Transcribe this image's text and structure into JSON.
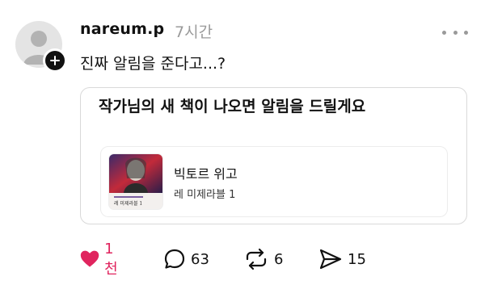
{
  "post": {
    "username": "nareum.p",
    "time": "7시간",
    "text": "진짜 알림을 준다고...?"
  },
  "quote": {
    "title": "작가님의 새 책이 나오면 알림을 드릴게요",
    "book": {
      "author": "빅토르 위고",
      "title": "레 미제라블 1",
      "cover_title": "레 미제라블 1"
    }
  },
  "actions": {
    "likes": "1천",
    "replies": "63",
    "reposts": "6",
    "shares": "15"
  },
  "colors": {
    "like_accent": "#e0245e",
    "muted_text": "#9a9a9a",
    "card_border": "#d9d9d9"
  },
  "icons": [
    "avatar-placeholder",
    "plus-icon",
    "more-icon",
    "heart-icon",
    "comment-icon",
    "repost-icon",
    "send-icon"
  ]
}
